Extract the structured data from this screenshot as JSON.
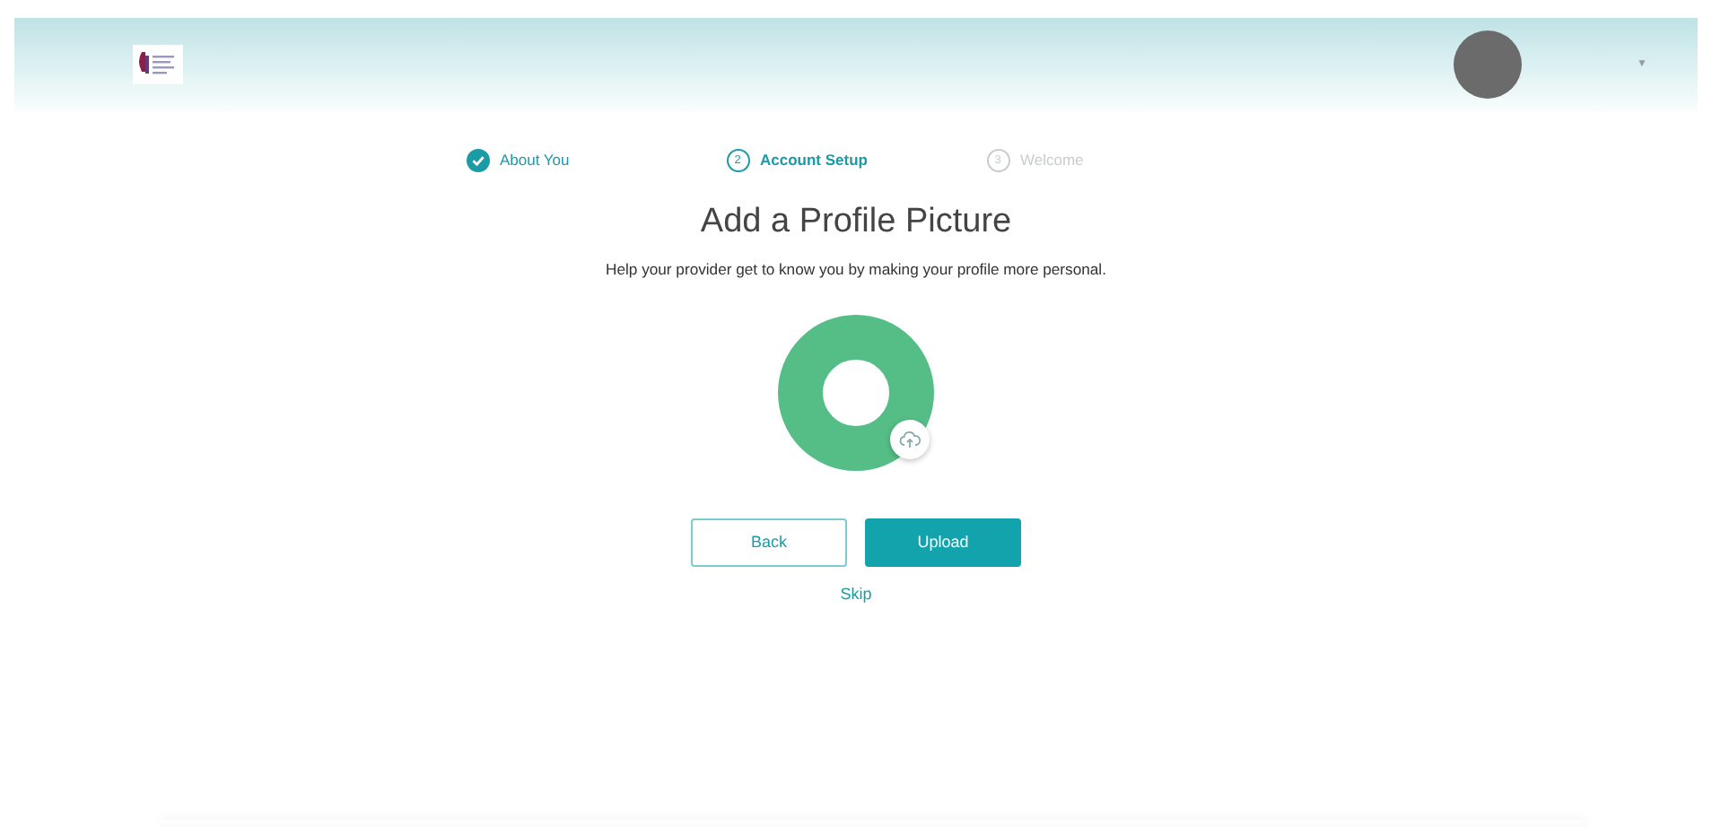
{
  "header": {
    "menu_caret": "▼"
  },
  "steps": [
    {
      "label": "About You",
      "completed": true,
      "selected": false
    },
    {
      "label": "Account Setup",
      "number": "2",
      "completed": false,
      "selected": true
    },
    {
      "label": "Welcome",
      "number": "3",
      "completed": false,
      "selected": false
    }
  ],
  "title": "Add a Profile Picture",
  "subtitle": "Help your provider get to know you by making your profile more personal.",
  "buttons": [
    {
      "label": "Back",
      "kind": "outline"
    },
    {
      "label": "Upload",
      "kind": "primary"
    }
  ],
  "skip_link": "Skip"
}
